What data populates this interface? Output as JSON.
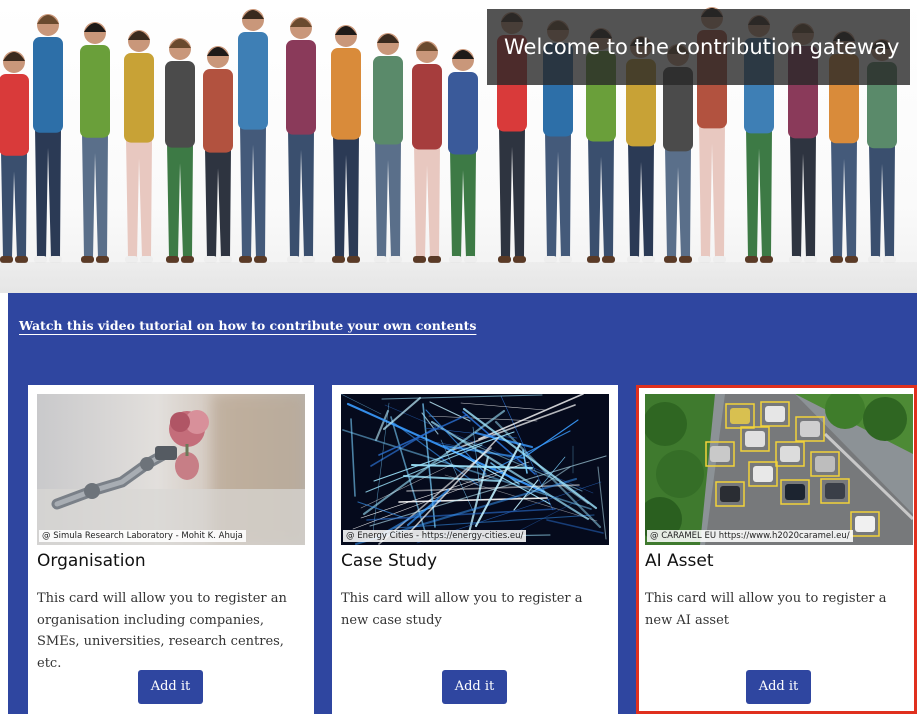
{
  "hero": {
    "welcome_text": "Welcome to the contribution gateway",
    "image_alt": "group of students reading"
  },
  "tutorial": {
    "link_text": "Watch this video tutorial on how to contribute your own contents"
  },
  "cards": [
    {
      "title": "Organisation",
      "credit": "@ Simula Research Laboratory - Mohit K. Ahuja",
      "description": "This card will allow you to register an organisation including companies, SMEs, universities, research centres, etc.",
      "button_label": "Add it",
      "highlighted": false
    },
    {
      "title": "Case Study",
      "credit": "@ Energy Cities - https://energy-cities.eu/",
      "description": "This card will allow you to register a new case study",
      "button_label": "Add it",
      "highlighted": false
    },
    {
      "title": "AI Asset",
      "credit": "@ CARAMEL EU https://www.h2020caramel.eu/",
      "description": "This card will allow you to register a new AI asset",
      "button_label": "Add it",
      "highlighted": true
    }
  ],
  "colors": {
    "brand_blue": "#2f46a0",
    "highlight_border": "#e0301e",
    "overlay": "#282828"
  }
}
